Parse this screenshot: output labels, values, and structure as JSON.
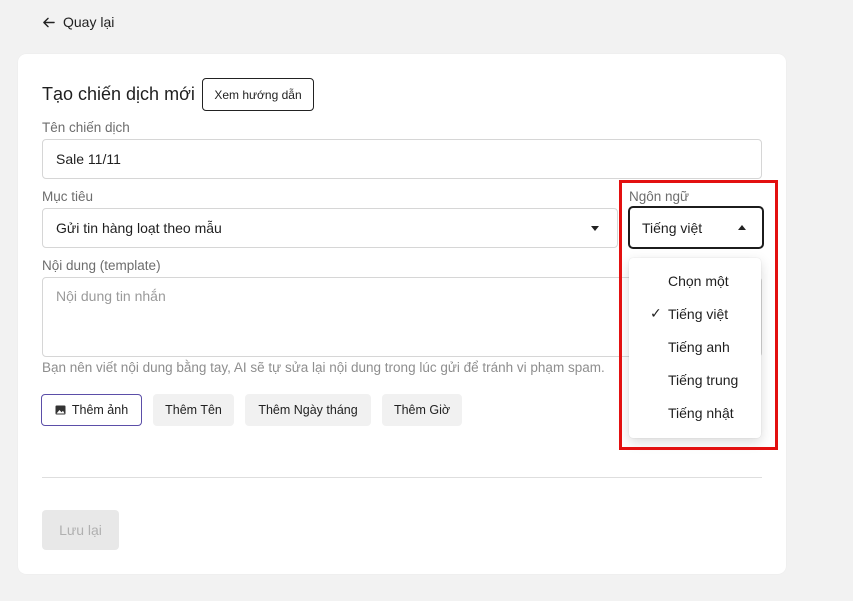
{
  "nav": {
    "back_label": "Quay lại"
  },
  "header": {
    "title": "Tạo chiến dịch mới",
    "guide_button": "Xem hướng dẫn"
  },
  "form": {
    "campaign_name": {
      "label": "Tên chiến dịch",
      "value": "Sale 11/11"
    },
    "goal": {
      "label": "Mục tiêu",
      "value": "Gửi tin hàng loạt theo mẫu"
    },
    "language": {
      "label": "Ngôn ngữ",
      "value": "Tiếng việt",
      "options": [
        "Chọn một",
        "Tiếng việt",
        "Tiếng anh",
        "Tiếng trung",
        "Tiếng nhật"
      ],
      "selected_check": "✓"
    },
    "content": {
      "label": "Nội dung (template)",
      "placeholder": "Nội dung tin nhắn",
      "helper": "Bạn nên viết nội dung bằng tay, AI sẽ tự sửa lại nội dung trong lúc gửi để tránh vi phạm spam."
    },
    "chips": [
      "Thêm ảnh",
      "Thêm Tên",
      "Thêm Ngày tháng",
      "Thêm Giờ"
    ],
    "save_label": "Lưu lại"
  },
  "icons": {
    "back": "arrow-left-icon",
    "image": "image-icon",
    "dropdown": "caret-down-icon",
    "dropdown_open": "caret-up-icon",
    "check": "check-icon"
  },
  "colors": {
    "highlight": "#e31010",
    "chip_image_border": "#5b4ea8",
    "page_bg": "#f2f2f2"
  }
}
